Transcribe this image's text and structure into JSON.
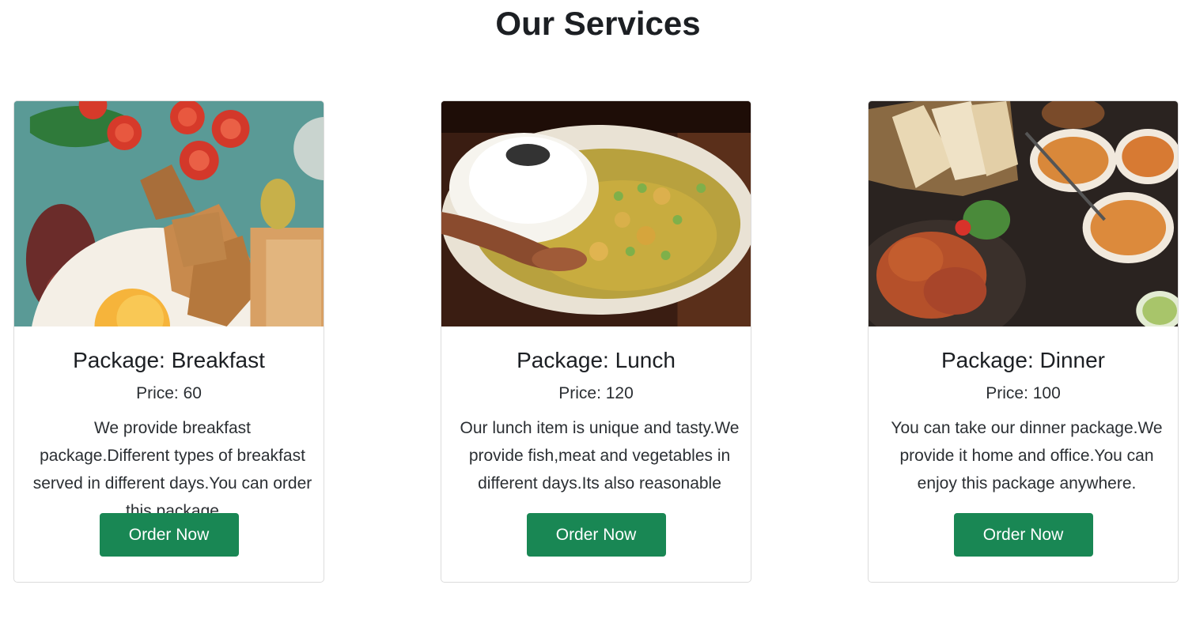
{
  "page": {
    "title": "Our Services"
  },
  "cards": [
    {
      "image": "breakfast-photo",
      "title": "Package: Breakfast",
      "price": "Price: 60",
      "description": "We provide breakfast package.Different types of breakfast served in different days.You can order this package",
      "button": "Order Now"
    },
    {
      "image": "lunch-photo",
      "title": "Package: Lunch",
      "price": "Price: 120",
      "description": "Our lunch item is unique and tasty.We provide fish,meat and vegetables in different days.Its also reasonable",
      "button": "Order Now"
    },
    {
      "image": "dinner-photo",
      "title": "Package: Dinner",
      "price": "Price: 100",
      "description": "You can take our dinner package.We provide it home and office.You can enjoy this package anywhere.",
      "button": "Order Now"
    }
  ],
  "colors": {
    "accent": "#198754",
    "border": "#dcdcdc"
  }
}
